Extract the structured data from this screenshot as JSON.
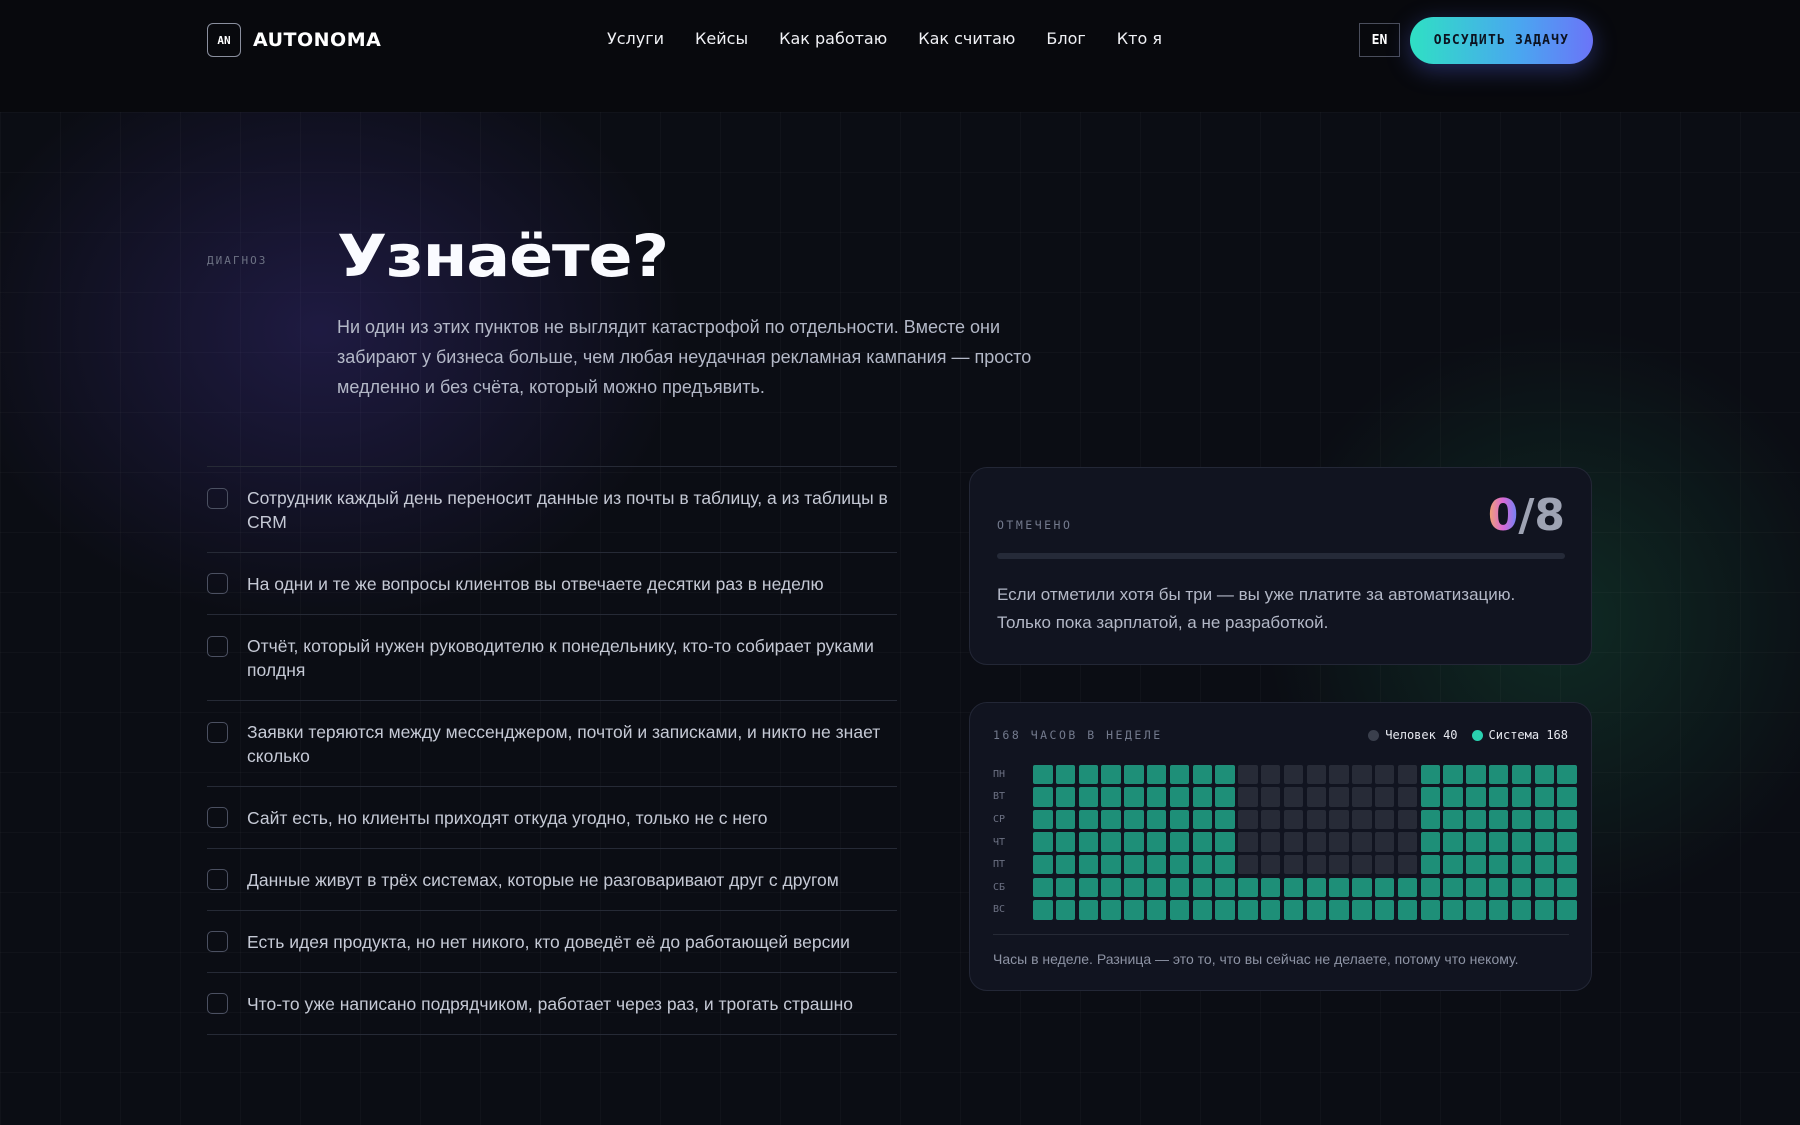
{
  "header": {
    "logo_badge": "AN",
    "logo_text": "AUTONOMA",
    "nav": [
      "Услуги",
      "Кейсы",
      "Как работаю",
      "Как считаю",
      "Блог",
      "Кто я"
    ],
    "lang": "EN",
    "cta": "ОБСУДИТЬ ЗАДАЧУ"
  },
  "section": {
    "tag": "ДИАГНОЗ",
    "title": "Узнаёте?",
    "intro": "Ни один из этих пунктов не выглядит катастрофой по отдельности. Вместе они забирают у бизнеса больше, чем любая неудачная рекламная кампания — просто медленно и без счёта, который можно предъявить."
  },
  "checklist": [
    {
      "text": "Сотрудник каждый день переносит данные из почты в таблицу, а из таблицы в CRM",
      "checked": false
    },
    {
      "text": "На одни и те же вопросы клиентов вы отвечаете десятки раз в неделю",
      "checked": false
    },
    {
      "text": "Отчёт, который нужен руководителю к понедельнику, кто-то собирает руками полдня",
      "checked": false
    },
    {
      "text": "Заявки теряются между мессенджером, почтой и записками, и никто не знает сколько",
      "checked": false
    },
    {
      "text": "Сайт есть, но клиенты приходят откуда угодно, только не с него",
      "checked": false
    },
    {
      "text": "Данные живут в трёх системах, которые не разговаривают друг с другом",
      "checked": false
    },
    {
      "text": "Есть идея продукта, но нет никого, кто доведёт её до работающей версии",
      "checked": false
    },
    {
      "text": "Что-то уже написано подрядчиком, работает через раз, и трогать страшно",
      "checked": false
    }
  ],
  "score_card": {
    "label": "ОТМЕЧЕНО",
    "count": "0",
    "total": "/8",
    "progress": 0,
    "note": "Если отметили хотя бы три — вы уже платите за автоматизацию. Только пока зарплатой, а не разработкой."
  },
  "hours_card": {
    "label": "168 ЧАСОВ В НЕДЕЛЕ",
    "legend_human": "Человек 40",
    "legend_system": "Система 168",
    "colors": {
      "human": "#3a3f4c",
      "system": "#2ad1b0",
      "system_cell": "#1e8f78",
      "human_cell": "#272b37"
    },
    "days": [
      "ПН",
      "ВТ",
      "СР",
      "ЧТ",
      "ПТ",
      "СБ",
      "ВС"
    ],
    "hours_per_day": 24,
    "human_hours_weekdays": [
      9,
      10,
      11,
      12,
      13,
      14,
      15,
      16
    ],
    "human_days": 5,
    "caption": "Часы в неделе. Разница — это то, что вы сейчас не делаете, потому что некому."
  }
}
